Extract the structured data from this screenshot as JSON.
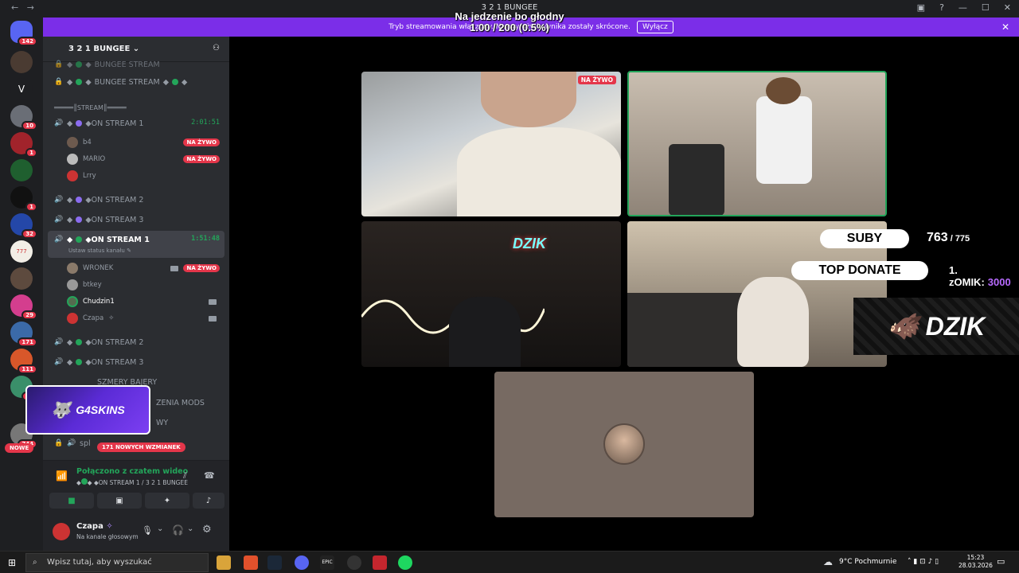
{
  "titlebar": {
    "title": "3 2 1 BUNGEE",
    "back": "←",
    "forward": "→"
  },
  "overlay": {
    "line1": "Na jedzenie bo głodny",
    "line2": "1.00 / 200 (0.5%)"
  },
  "banner": {
    "text": "Tryb streamowania włączony. Nazwy użytkownika zostały skrócone.",
    "button": "Wyłącz"
  },
  "servers": {
    "badges": [
      "142",
      "10",
      "1",
      "1",
      "32",
      "29",
      "171",
      "111",
      "14",
      "744"
    ],
    "letter_v": "V",
    "tile_777": "777"
  },
  "sidebar": {
    "server_name": "3 2 1 BUNGEE",
    "channels": [
      {
        "name": "BUNGEE STREAM"
      },
      {
        "name": "BUNGEE STREAM"
      },
      {
        "name": "═════║STREAM║═════"
      },
      {
        "name": "◆ON STREAM 1",
        "timer": "2:01:51"
      },
      {
        "name": "◆ON STREAM 2"
      },
      {
        "name": "◆ON STREAM 3"
      },
      {
        "name": "◆ON STREAM 1",
        "timer": "1:51:48",
        "status": "Ustaw status kanału"
      },
      {
        "name": "◆ON STREAM 2"
      },
      {
        "name": "◆ON STREAM 3"
      },
      {
        "name": "SZMERY BAJERY"
      },
      {
        "name": "ZENIA MODS"
      },
      {
        "name": "WY"
      },
      {
        "name": "spl"
      }
    ],
    "users_stream1": [
      {
        "name": "b4",
        "live": "NA ŻYWO"
      },
      {
        "name": "MARIO",
        "live": "NA ŻYWO"
      },
      {
        "name": "Lrry"
      }
    ],
    "users_stream1b": [
      {
        "name": "WRONEK",
        "live": "NA ŻYWO"
      },
      {
        "name": "btkey"
      },
      {
        "name": "Chudzin1"
      },
      {
        "name": "Czapa"
      }
    ],
    "mentions": "171 NOWYCH WZMIANEK",
    "new_label": "NOWE",
    "promo": "G4SKINS"
  },
  "voice": {
    "status": "Połączono z czatem wideo",
    "channel": "◆ON STREAM 1 / 3 2 1 BUNGEE"
  },
  "user": {
    "name": "Czapa",
    "status": "Na kanale głosowym"
  },
  "stage": {
    "live_label": "NA ŻYWO",
    "suby_label": "SUBY",
    "suby_value": "763",
    "suby_total": "/ 775",
    "top_donate": "TOP DONATE",
    "top_donor": "1. zOMIK:",
    "top_amount": "3000",
    "neon_sign": "DZIK",
    "brand": "DZIK"
  },
  "taskbar": {
    "search_placeholder": "Wpisz tutaj, aby wyszukać",
    "weather": "9°C  Pochmurnie",
    "time": "15:23",
    "date": "28.03.2026",
    "epic_label": "EPIC"
  },
  "colors": {
    "accent": "#7b2ee8",
    "live": "#e4364a",
    "online": "#23a55a"
  }
}
